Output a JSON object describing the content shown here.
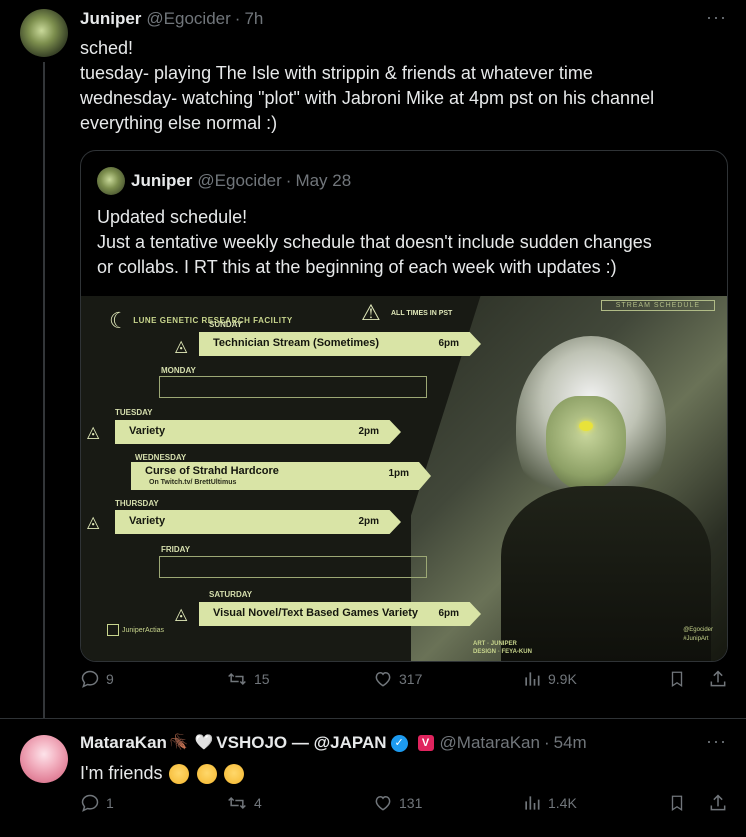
{
  "tweet": {
    "name": "Juniper",
    "handle": "@Egocider",
    "dot": "·",
    "time": "7h",
    "more": "···",
    "lines": [
      "sched!",
      "tuesday- playing The Isle with strippin & friends at whatever time",
      "wednesday- watching \"plot\" with Jabroni Mike at 4pm pst on his channel",
      "everything else normal :)"
    ],
    "stats": {
      "replies": "9",
      "reposts": "15",
      "likes": "317",
      "views": "9.9K"
    }
  },
  "quote": {
    "name": "Juniper",
    "handle": "@Egocider",
    "dot": "·",
    "time": "May 28",
    "lines": [
      "Updated schedule!",
      "Just a tentative weekly schedule that doesn't include sudden changes",
      "or collabs. I RT this at the beginning of each week with updates :)"
    ],
    "image": {
      "facility": "LUNE GENETIC RESEARCH FACILITY",
      "pst": "ALL TIMES IN PST",
      "header_label": "STREAM SCHEDULE",
      "days": [
        {
          "day": "SUNDAY",
          "title": "Technician Stream (Sometimes)",
          "time": "6pm",
          "sub": ""
        },
        {
          "day": "MONDAY",
          "title": "",
          "time": "",
          "sub": ""
        },
        {
          "day": "TUESDAY",
          "title": "Variety",
          "time": "2pm",
          "sub": ""
        },
        {
          "day": "WEDNESDAY",
          "title": "Curse of Strahd Hardcore",
          "time": "1pm",
          "sub": "On Twitch.tv/ BrettUltimus"
        },
        {
          "day": "THURSDAY",
          "title": "Variety",
          "time": "2pm",
          "sub": ""
        },
        {
          "day": "FRIDAY",
          "title": "",
          "time": "",
          "sub": ""
        },
        {
          "day": "SATURDAY",
          "title": "Visual Novel/Text Based Games Variety",
          "time": "6pm",
          "sub": ""
        }
      ],
      "twitch": "JuniperActias",
      "credit_art": "ART ◦ JUNIPER",
      "credit_design": "DESIGN ◦ FEYA-KUN",
      "tag1": "@Egocider",
      "tag2": "#JunipArt"
    }
  },
  "reply": {
    "name": "MataraKan",
    "mid": "VSHOJO — @JAPAN",
    "handle": "@MataraKan",
    "dot": "·",
    "time": "54m",
    "more": "···",
    "text": "I'm friends",
    "stats": {
      "replies": "1",
      "reposts": "4",
      "likes": "131",
      "views": "1.4K"
    }
  },
  "icons": {
    "reply": "reply-icon",
    "repost": "repost-icon",
    "like": "heart-icon",
    "views": "views-icon",
    "bookmark": "bookmark-icon",
    "share": "share-icon"
  },
  "colors": {
    "background": "#000000",
    "text": "#e7e9ea",
    "muted": "#71767b",
    "border": "#2f3336",
    "verified": "#1d9bf0",
    "accent": "#d9e4a6"
  }
}
